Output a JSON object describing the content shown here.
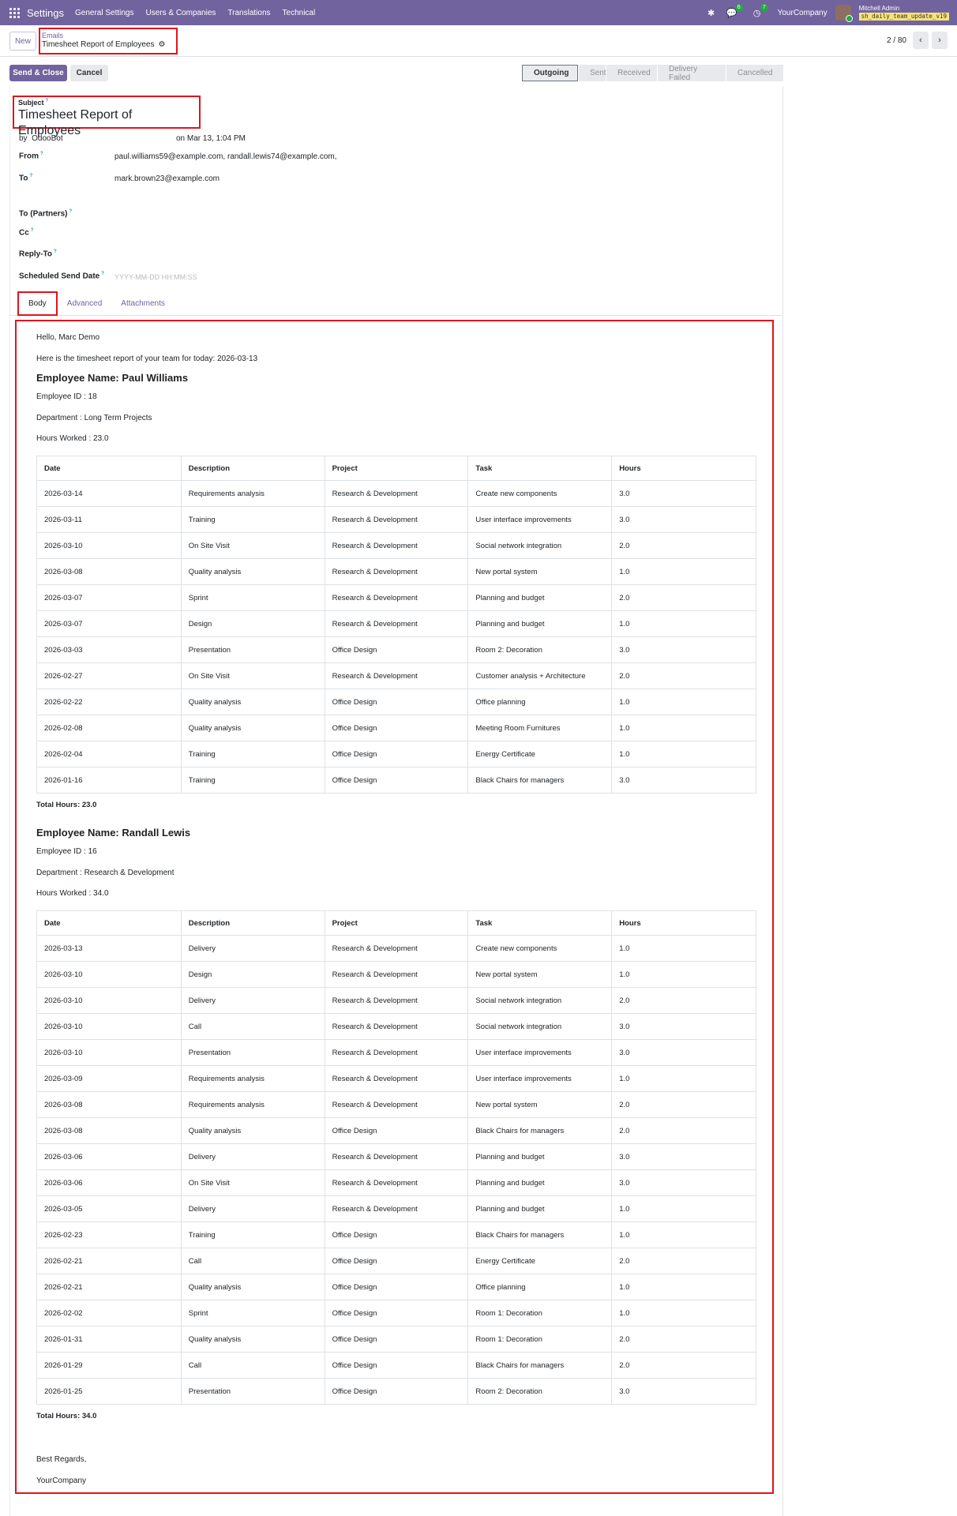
{
  "navbar": {
    "brand": "Settings",
    "menu": [
      "General Settings",
      "Users & Companies",
      "Translations",
      "Technical"
    ],
    "messages_badge": "6",
    "activities_badge": "7",
    "company": "YourCompany",
    "user_name": "Mitchell Admin",
    "db_name": "sh_daily_team_update_v19"
  },
  "control": {
    "new_label": "New",
    "breadcrumb_parent": "Emails",
    "breadcrumb_current": "Timesheet Report of Employees",
    "pager_value": "2 / 80"
  },
  "toolbar": {
    "send_close_label": "Send & Close",
    "cancel_label": "Cancel",
    "stages": [
      "Outgoing",
      "Sent",
      "Received",
      "Delivery Failed",
      "Cancelled"
    ],
    "active_stage": "Outgoing"
  },
  "form": {
    "subject_label": "Subject",
    "subject_value": "Timesheet Report of Employees",
    "by_prefix": "by",
    "author": "OdooBot",
    "date_text": "on Mar 13, 1:04 PM",
    "from_label": "From",
    "from_value": "paul.williams59@example.com, randall.lewis74@example.com,",
    "to_label": "To",
    "to_value": "mark.brown23@example.com",
    "to_partners_label": "To (Partners)",
    "cc_label": "Cc",
    "reply_to_label": "Reply-To",
    "scheduled_label": "Scheduled Send Date",
    "scheduled_placeholder": "YYYY-MM-DD HH:MM:SS"
  },
  "tabs": [
    "Body",
    "Advanced",
    "Attachments"
  ],
  "mail": {
    "greeting": "Hello, Marc Demo",
    "intro": "Here is the timesheet report of your team for today: 2026-03-13",
    "columns": [
      "Date",
      "Description",
      "Project",
      "Task",
      "Hours"
    ],
    "employees": [
      {
        "name": "Employee Name: Paul Williams",
        "id_text": "Employee ID : 18",
        "dept_text": "Department : Long Term Projects",
        "hours_text": "Hours Worked : 23.0",
        "rows": [
          [
            "2026-03-14",
            "Requirements analysis",
            "Research & Development",
            "Create new components",
            "3.0"
          ],
          [
            "2026-03-11",
            "Training",
            "Research & Development",
            "User interface improvements",
            "3.0"
          ],
          [
            "2026-03-10",
            "On Site Visit",
            "Research & Development",
            "Social network integration",
            "2.0"
          ],
          [
            "2026-03-08",
            "Quality analysis",
            "Research & Development",
            "New portal system",
            "1.0"
          ],
          [
            "2026-03-07",
            "Sprint",
            "Research & Development",
            "Planning and budget",
            "2.0"
          ],
          [
            "2026-03-07",
            "Design",
            "Research & Development",
            "Planning and budget",
            "1.0"
          ],
          [
            "2026-03-03",
            "Presentation",
            "Office Design",
            "Room 2: Decoration",
            "3.0"
          ],
          [
            "2026-02-27",
            "On Site Visit",
            "Research & Development",
            "Customer analysis + Architecture",
            "2.0"
          ],
          [
            "2026-02-22",
            "Quality analysis",
            "Office Design",
            "Office planning",
            "1.0"
          ],
          [
            "2026-02-08",
            "Quality analysis",
            "Office Design",
            "Meeting Room Furnitures",
            "1.0"
          ],
          [
            "2026-02-04",
            "Training",
            "Office Design",
            "Energy Certificate",
            "1.0"
          ],
          [
            "2026-01-16",
            "Training",
            "Office Design",
            "Black Chairs for managers",
            "3.0"
          ]
        ],
        "total_text": "Total Hours: 23.0"
      },
      {
        "name": "Employee Name: Randall Lewis",
        "id_text": "Employee ID : 16",
        "dept_text": "Department : Research & Development",
        "hours_text": "Hours Worked : 34.0",
        "rows": [
          [
            "2026-03-13",
            "Delivery",
            "Research & Development",
            "Create new components",
            "1.0"
          ],
          [
            "2026-03-10",
            "Design",
            "Research & Development",
            "New portal system",
            "1.0"
          ],
          [
            "2026-03-10",
            "Delivery",
            "Research & Development",
            "Social network integration",
            "2.0"
          ],
          [
            "2026-03-10",
            "Call",
            "Research & Development",
            "Social network integration",
            "3.0"
          ],
          [
            "2026-03-10",
            "Presentation",
            "Research & Development",
            "User interface improvements",
            "3.0"
          ],
          [
            "2026-03-09",
            "Requirements analysis",
            "Research & Development",
            "User interface improvements",
            "1.0"
          ],
          [
            "2026-03-08",
            "Requirements analysis",
            "Research & Development",
            "New portal system",
            "2.0"
          ],
          [
            "2026-03-08",
            "Quality analysis",
            "Office Design",
            "Black Chairs for managers",
            "2.0"
          ],
          [
            "2026-03-06",
            "Delivery",
            "Research & Development",
            "Planning and budget",
            "3.0"
          ],
          [
            "2026-03-06",
            "On Site Visit",
            "Research & Development",
            "Planning and budget",
            "3.0"
          ],
          [
            "2026-03-05",
            "Delivery",
            "Research & Development",
            "Planning and budget",
            "1.0"
          ],
          [
            "2026-02-23",
            "Training",
            "Office Design",
            "Black Chairs for managers",
            "1.0"
          ],
          [
            "2026-02-21",
            "Call",
            "Office Design",
            "Energy Certificate",
            "2.0"
          ],
          [
            "2026-02-21",
            "Quality analysis",
            "Office Design",
            "Office planning",
            "1.0"
          ],
          [
            "2026-02-02",
            "Sprint",
            "Office Design",
            "Room 1: Decoration",
            "1.0"
          ],
          [
            "2026-01-31",
            "Quality analysis",
            "Office Design",
            "Room 1: Decoration",
            "2.0"
          ],
          [
            "2026-01-29",
            "Call",
            "Office Design",
            "Black Chairs for managers",
            "2.0"
          ],
          [
            "2026-01-25",
            "Presentation",
            "Office Design",
            "Room 2: Decoration",
            "3.0"
          ]
        ],
        "total_text": "Total Hours: 34.0"
      }
    ],
    "regards": "Best Regards,",
    "signature": "YourCompany"
  }
}
